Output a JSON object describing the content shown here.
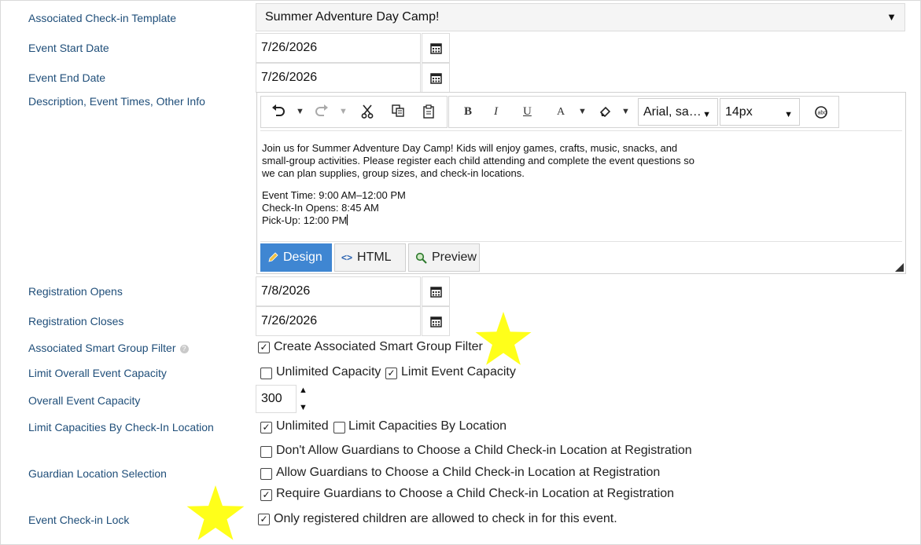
{
  "template": {
    "label": "Associated Check-in Template",
    "value": "Summer Adventure Day Camp!"
  },
  "event_start": {
    "label": "Event Start Date",
    "value": "7/26/2026"
  },
  "event_end": {
    "label": "Event End Date",
    "value": "7/26/2026"
  },
  "description": {
    "label": "Description, Event Times, Other Info",
    "toolbar": {
      "font_family": "Arial, sa…",
      "font_size": "14px"
    },
    "content": {
      "p1_l1": "Join us for Summer Adventure Day Camp! Kids will enjoy games, crafts, music, snacks, and",
      "p1_l2": "small-group activities. Please register each child attending and complete the event questions so",
      "p1_l3": "we can plan supplies, group sizes, and check-in locations.",
      "p2_l1": "Event Time: 9:00 AM–12:00 PM",
      "p2_l2": "Check-In Opens: 8:45 AM",
      "p2_l3": "Pick-Up: 12:00 PM"
    },
    "modes": {
      "design": "Design",
      "html": "HTML",
      "preview": "Preview"
    },
    "active_mode": "Design"
  },
  "registration_opens": {
    "label": "Registration Opens",
    "value": "7/8/2026"
  },
  "registration_closes": {
    "label": "Registration Closes",
    "value": "7/26/2026"
  },
  "smart_group": {
    "label": "Associated Smart Group Filter",
    "checkbox_label": "Create Associated Smart Group Filter",
    "checked": true
  },
  "limit_capacity": {
    "label": "Limit Overall Event Capacity",
    "options": [
      {
        "label": "Unlimited Capacity",
        "checked": false
      },
      {
        "label": "Limit Event Capacity",
        "checked": true
      }
    ]
  },
  "overall_capacity": {
    "label": "Overall Event Capacity",
    "value": "300"
  },
  "location_capacity": {
    "label": "Limit Capacities By Check-In Location",
    "options": [
      {
        "label": "Unlimited",
        "checked": true
      },
      {
        "label": "Limit Capacities By Location",
        "checked": false
      }
    ]
  },
  "guardian_location": {
    "label": "Guardian Location Selection",
    "options": [
      {
        "label": "Don't Allow Guardians to Choose a Child Check-in Location at Registration",
        "checked": false
      },
      {
        "label": "Allow Guardians to Choose a Child Check-in Location at Registration",
        "checked": false
      },
      {
        "label": "Require Guardians to Choose a Child Check-in Location at Registration",
        "checked": true
      }
    ]
  },
  "checkin_lock": {
    "label": "Event Check-in Lock",
    "checkbox_label": "Only registered children are allowed to check in for this event.",
    "checked": true
  },
  "colors": {
    "label": "#1f4e79",
    "accent": "#3f86d2",
    "highlight_star": "#ffff1a"
  },
  "icons": [
    "calendar-icon",
    "undo-icon",
    "redo-icon",
    "cut-icon",
    "copy-icon",
    "paste-icon",
    "bold-icon",
    "italic-icon",
    "underline-icon",
    "font-color-icon",
    "highlight-icon",
    "spellcheck-icon",
    "pencil-icon",
    "code-icon",
    "magnifier-icon",
    "star-icon"
  ]
}
